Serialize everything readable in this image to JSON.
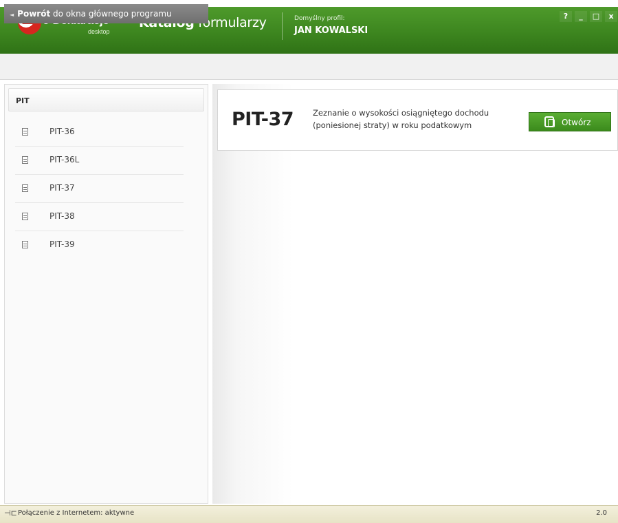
{
  "header": {
    "logo_text": "e-Deklaracje",
    "logo_sub": "desktop",
    "title_bold": "Katalog",
    "title_light": "formularzy",
    "profile_label": "Domyślny profil:",
    "profile_name": "JAN KOWALSKI",
    "window_buttons": {
      "help": "?",
      "minimize": "_",
      "maximize": "□",
      "close": "x"
    }
  },
  "toolbar": {
    "back_bold": "Powrót",
    "back_rest": "do okna głównego programu"
  },
  "sidebar": {
    "category": "PIT",
    "items": [
      {
        "label": "PIT-36"
      },
      {
        "label": "PIT-36L"
      },
      {
        "label": "PIT-37"
      },
      {
        "label": "PIT-38"
      },
      {
        "label": "PIT-39"
      }
    ]
  },
  "main": {
    "form_code": "PIT-37",
    "form_description": "Zeznanie o wysokości osiągniętego dochodu (poniesionej straty) w roku podatkowym",
    "open_label": "Otwórz"
  },
  "status": {
    "connection": "Połączenie z Internetem: aktywne",
    "version": "2.0"
  },
  "colors": {
    "header_green": "#3d861f",
    "button_green": "#4a9d28",
    "status_bg": "#ece8cf"
  }
}
